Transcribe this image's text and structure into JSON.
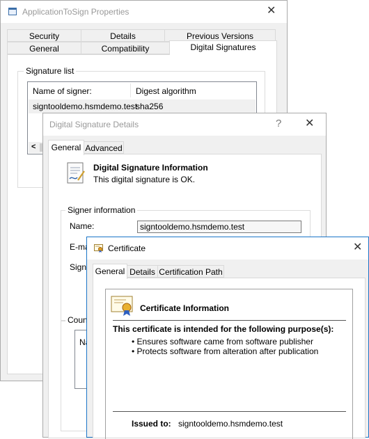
{
  "properties": {
    "title": "ApplicationToSign Properties",
    "close_glyph": "✕",
    "tabs_row1": [
      "Security",
      "Details",
      "Previous Versions"
    ],
    "tabs_row2": [
      "General",
      "Compatibility",
      "Digital Signatures"
    ],
    "signature_list_label": "Signature list",
    "columns": [
      "Name of signer:",
      "Digest algorithm"
    ],
    "row": {
      "signer": "signtooldemo.hsmdemo.test",
      "digest": "sha256"
    },
    "scroll_left_glyph": "<"
  },
  "details": {
    "title": "Digital Signature Details",
    "help_glyph": "?",
    "close_glyph": "✕",
    "tabs": [
      "General",
      "Advanced"
    ],
    "info_heading": "Digital Signature Information",
    "info_text": "This digital signature is OK.",
    "signer_group_label": "Signer information",
    "name_label": "Name:",
    "name_value": "signtooldemo.hsmdemo.test",
    "email_label_partial": "E-mai",
    "signing_label_partial": "Signin",
    "counter_label_partial": "Count",
    "counter_col_partial": "Nar"
  },
  "certificate": {
    "title": "Certificate",
    "close_glyph": "✕",
    "tabs": [
      "General",
      "Details",
      "Certification Path"
    ],
    "info_heading": "Certificate Information",
    "purpose_heading": "This certificate is intended for the following purpose(s):",
    "purposes": [
      "• Ensures software came from software publisher",
      "• Protects software from alteration after publication"
    ],
    "issued_to_label": "Issued to:",
    "issued_to_value": "signtooldemo.hsmdemo.test"
  },
  "colors": {
    "accent": "#1a75c8",
    "selected_row": "#f0f0f0"
  }
}
